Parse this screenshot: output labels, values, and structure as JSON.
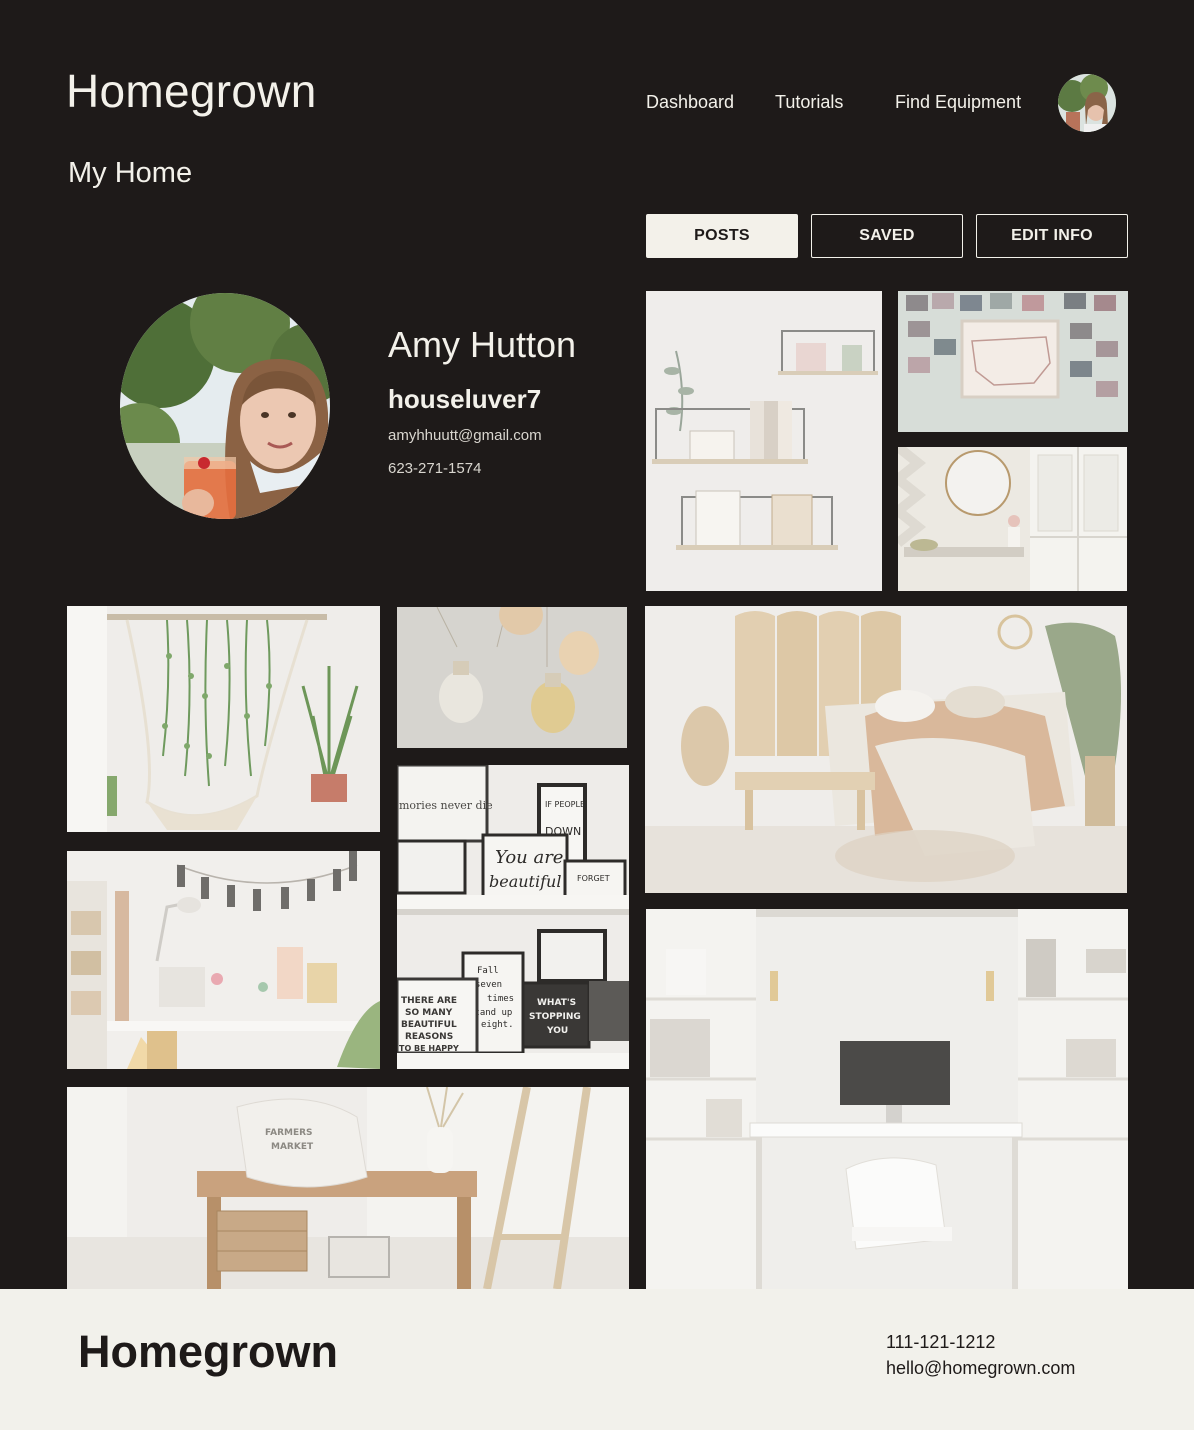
{
  "header": {
    "logo": "Homegrown",
    "nav": [
      "Dashboard",
      "Tutorials",
      "Find Equipment"
    ]
  },
  "page": {
    "title": "My Home"
  },
  "tabs": {
    "posts": "POSTS",
    "saved": "SAVED",
    "edit": "EDIT INFO",
    "active": "posts"
  },
  "profile": {
    "name": "Amy Hutton",
    "username": "houseluver7",
    "email": "amyhhuutt@gmail.com",
    "phone": "623-271-1574"
  },
  "photo_text": {
    "frame_memories": "mories never die",
    "frame_you_are": "You are",
    "frame_beautiful": "beautiful",
    "frame_if_people": "IF PEOPLE",
    "frame_down": "DOWN",
    "frame_forget": "FORGET",
    "frame_fall": "Fall",
    "frame_seven": "seven",
    "frame_times": "times",
    "frame_stand_up": "stand up",
    "frame_eight": "eight.",
    "frame_there_are": "THERE ARE",
    "frame_so_many": "SO MANY",
    "frame_beautiful_caps": "BEAUTIFUL",
    "frame_reasons": "REASONS",
    "frame_to_be_happy": "TO BE HAPPY",
    "frame_whats": "WHAT'S",
    "frame_stopping": "STOPPING",
    "frame_you": "YOU",
    "pillow_farmers": "FARMERS",
    "pillow_market": "MARKET"
  },
  "footer": {
    "logo": "Homegrown",
    "phone": "111-121-1212",
    "email": "hello@homegrown.com"
  },
  "colors": {
    "background": "#1e1a19",
    "cream": "#f3f1ea",
    "footer_bg": "#f2f1eb"
  }
}
